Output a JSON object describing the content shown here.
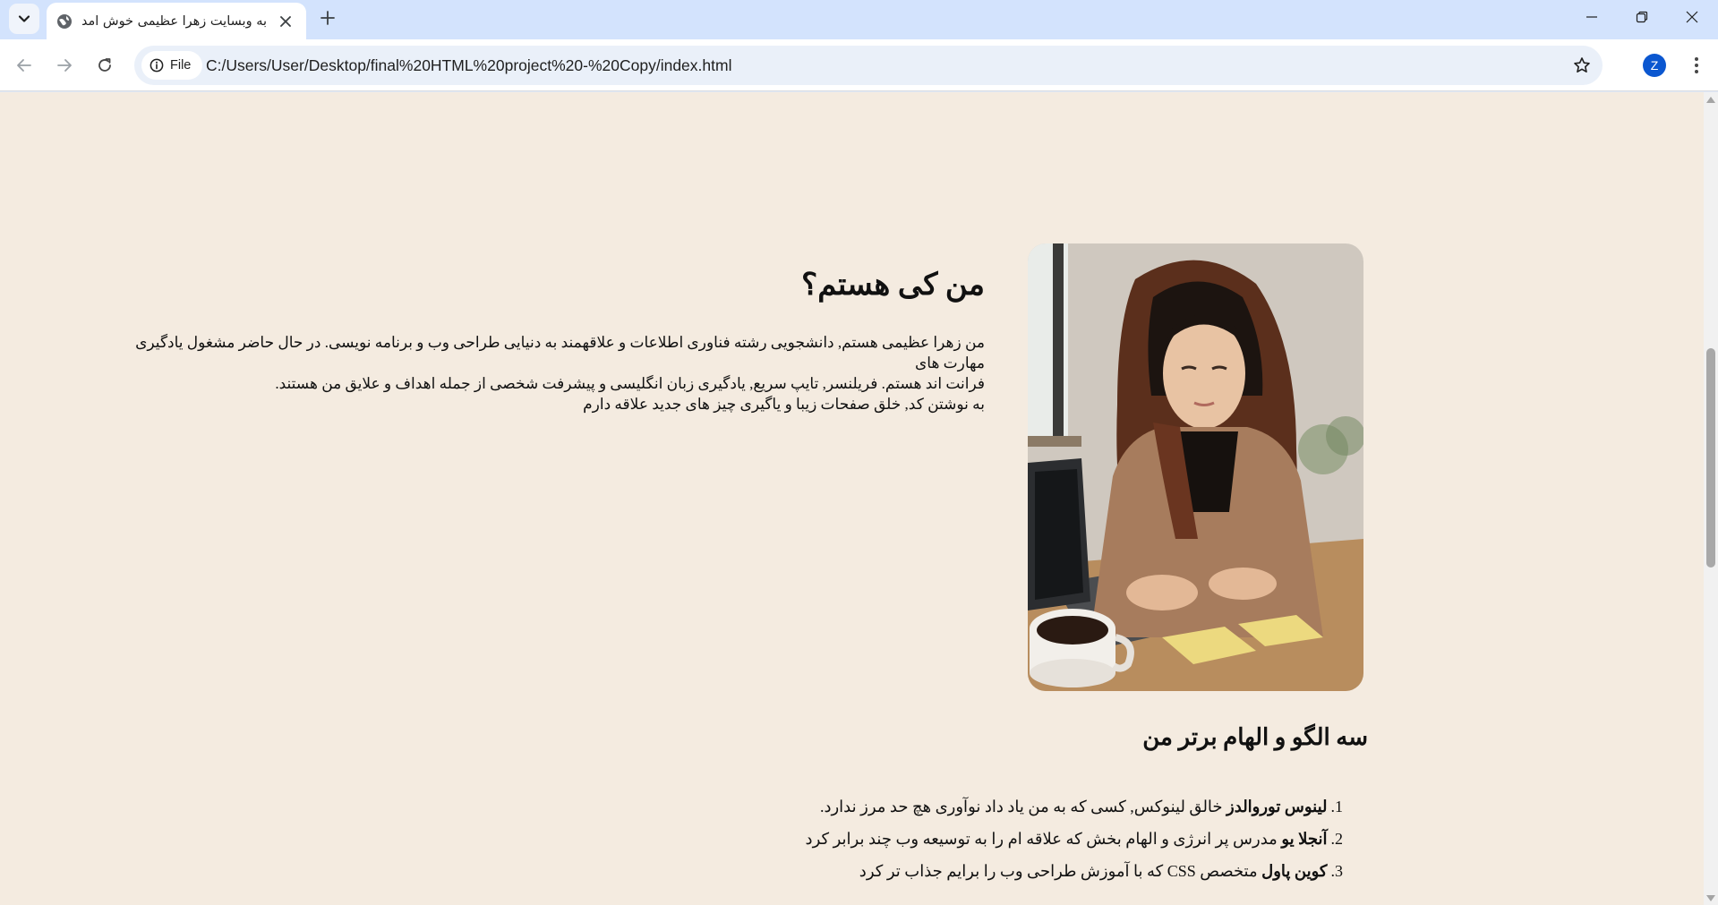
{
  "browser": {
    "tab": {
      "title": "به وبسایت زهرا عظیمی خوش آمدید"
    },
    "address_bar": {
      "security_chip": "File",
      "url": "C:/Users/User/Desktop/final%20HTML%20project%20-%20Copy/index.html"
    },
    "profile_initial": "Z"
  },
  "page": {
    "about": {
      "title": "من کی هستم؟",
      "paragraph_lines": [
        "من زهرا عظیمی هستم, دانشجویی رشته فناوری اطلاعات و علاقهمند به دنیایی طراحی وب و برنامه نویسی. در حال حاضر مشغول یادگیری مهارت های",
        "فرانت اند هستم. فریلنسر, تایپ سریع, یادگیری زبان انگلیسی و پیشرفت شخصی از جمله اهداف و علایق من هستند.",
        "به نوشتن کد, خلق صفحات زیبا و یاگیری چیز های جدید علاقه دارم"
      ]
    },
    "idols": {
      "title": "سه الگو و الهام برتر من",
      "items": [
        {
          "number": "1.",
          "name": "لینوس توروالدز",
          "text": " خالق لینوکس, کسی که به من یاد داد نوآوری هچ حد مرز ندارد."
        },
        {
          "number": "2.",
          "name": "آنجلا یو",
          "text": " مدرس پر انرژی و الهام بخش که علاقه ام را به توسیعه وب چند برابر کرد"
        },
        {
          "number": "3.",
          "name": "کوین پاول",
          "text": " متخصص CSS که با آموزش طراحی وب را برایم جذاب تر کرد"
        }
      ]
    }
  },
  "colors": {
    "page_background": "#f4ebe0",
    "tabstrip_background": "#d3e3fd",
    "avatar_background": "#0b57d0"
  }
}
